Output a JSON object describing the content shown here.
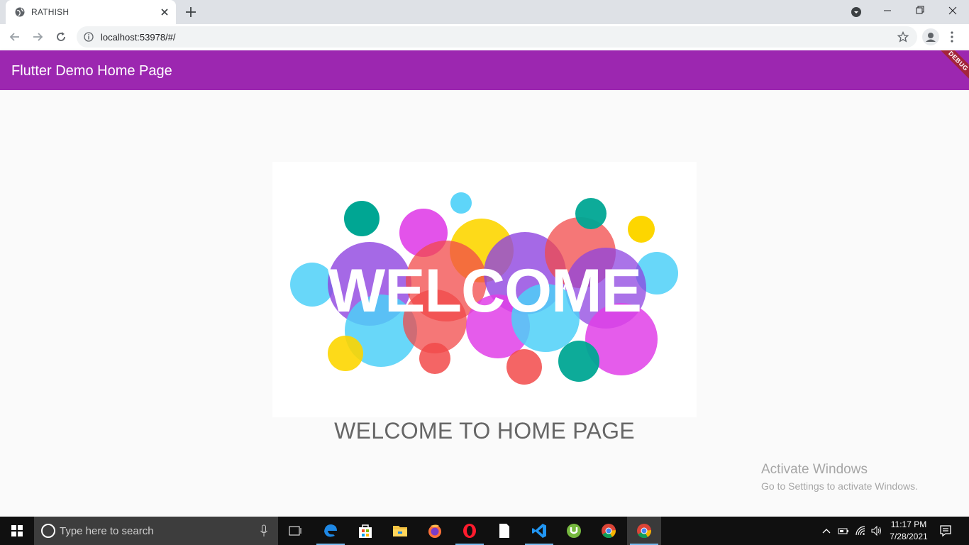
{
  "browser": {
    "tab_title": "RATHISH",
    "url": "localhost:53978/#/"
  },
  "app": {
    "appbar_title": "Flutter Demo Home Page",
    "debug_banner": "DEBUG",
    "welcome_word": "WELCOME",
    "caption": "WELCOME TO HOME PAGE"
  },
  "watermark": {
    "title": "Activate Windows",
    "subtitle": "Go to Settings to activate Windows."
  },
  "taskbar": {
    "search_placeholder": "Type here to search",
    "apps": [
      "task-view-icon",
      "edge-icon",
      "store-icon",
      "file-explorer-icon",
      "firefox-icon",
      "opera-icon",
      "notepad-icon",
      "vscode-icon",
      "utorrent-icon",
      "chrome-icon",
      "chrome-active-icon"
    ],
    "time": "11:17 PM",
    "date": "7/28/2021"
  },
  "colors": {
    "appbar": "#9c27b0",
    "debug": "#a3243a",
    "taskbar": "#101010"
  }
}
